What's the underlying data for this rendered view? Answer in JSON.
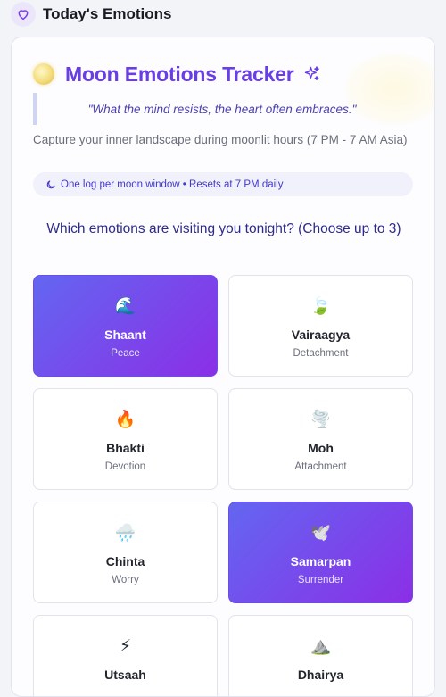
{
  "header": {
    "title": "Today's Emotions",
    "icon": "heart-icon"
  },
  "tracker": {
    "title": "Moon Emotions Tracker",
    "quote": "\"What the mind resists, the heart often embraces.\"",
    "subtitle": "Capture your inner landscape during moonlit hours (7 PM - 7 AM Asia)",
    "policy": "One log per moon window • Resets at 7 PM daily",
    "question": "Which emotions are visiting you tonight? (Choose up to 3)"
  },
  "colors": {
    "accent": "#6a3ee6",
    "selected_gradient_start": "#6366f1",
    "selected_gradient_end": "#8b2fe6"
  },
  "emotions": [
    {
      "emoji": "🌊",
      "name": "Shaant",
      "meaning": "Peace",
      "selected": true
    },
    {
      "emoji": "🍃",
      "name": "Vairaagya",
      "meaning": "Detachment",
      "selected": false
    },
    {
      "emoji": "🔥",
      "name": "Bhakti",
      "meaning": "Devotion",
      "selected": false
    },
    {
      "emoji": "🌪️",
      "name": "Moh",
      "meaning": "Attachment",
      "selected": false
    },
    {
      "emoji": "🌧️",
      "name": "Chinta",
      "meaning": "Worry",
      "selected": false
    },
    {
      "emoji": "🕊️",
      "name": "Samarpan",
      "meaning": "Surrender",
      "selected": true
    },
    {
      "emoji": "⚡",
      "name": "Utsaah",
      "meaning": "",
      "selected": false
    },
    {
      "emoji": "⛰️",
      "name": "Dhairya",
      "meaning": "",
      "selected": false
    }
  ]
}
